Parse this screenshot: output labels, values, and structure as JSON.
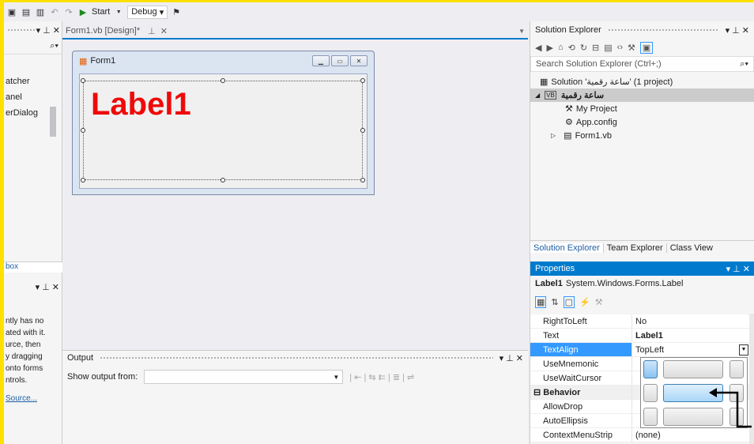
{
  "toolbar": {
    "start_label": "Start",
    "config_value": "Debug"
  },
  "left_panel": {
    "items": [
      "atcher",
      "anel",
      "erDialog"
    ],
    "bottom_tab": "box",
    "text_lines": [
      "ntly has no",
      "ated with it.",
      "urce, then",
      "y dragging",
      "onto forms",
      "ntrols."
    ],
    "link": "Source..."
  },
  "designer": {
    "tab_label": "Form1.vb [Design]*",
    "form_title": "Form1",
    "label_text": "Label1"
  },
  "output": {
    "title": "Output",
    "show_from_label": "Show output from:",
    "show_from_value": ""
  },
  "solution_explorer": {
    "title": "Solution Explorer",
    "search_placeholder": "Search Solution Explorer (Ctrl+;)",
    "solution_label": "Solution 'ساعة رقمية' (1 project)",
    "project_label": "ساعة رقمية",
    "items": [
      "My Project",
      "App.config",
      "Form1.vb"
    ],
    "tabs": [
      "Solution Explorer",
      "Team Explorer",
      "Class View"
    ]
  },
  "properties": {
    "title": "Properties",
    "object_name": "Label1",
    "object_type": "System.Windows.Forms.Label",
    "rows": [
      {
        "name": "RightToLeft",
        "value": "No"
      },
      {
        "name": "Text",
        "value": "Label1"
      },
      {
        "name": "TextAlign",
        "value": "TopLeft"
      },
      {
        "name": "UseMnemonic",
        "value": ""
      },
      {
        "name": "UseWaitCursor",
        "value": ""
      },
      {
        "name": "Behavior",
        "value": ""
      },
      {
        "name": "AllowDrop",
        "value": ""
      },
      {
        "name": "AutoEllipsis",
        "value": ""
      },
      {
        "name": "ContextMenuStrip",
        "value": "(none)"
      }
    ]
  },
  "colors": {
    "accent": "#007acc",
    "label_red": "#ee0a0a",
    "highlight": "#3399ff"
  }
}
